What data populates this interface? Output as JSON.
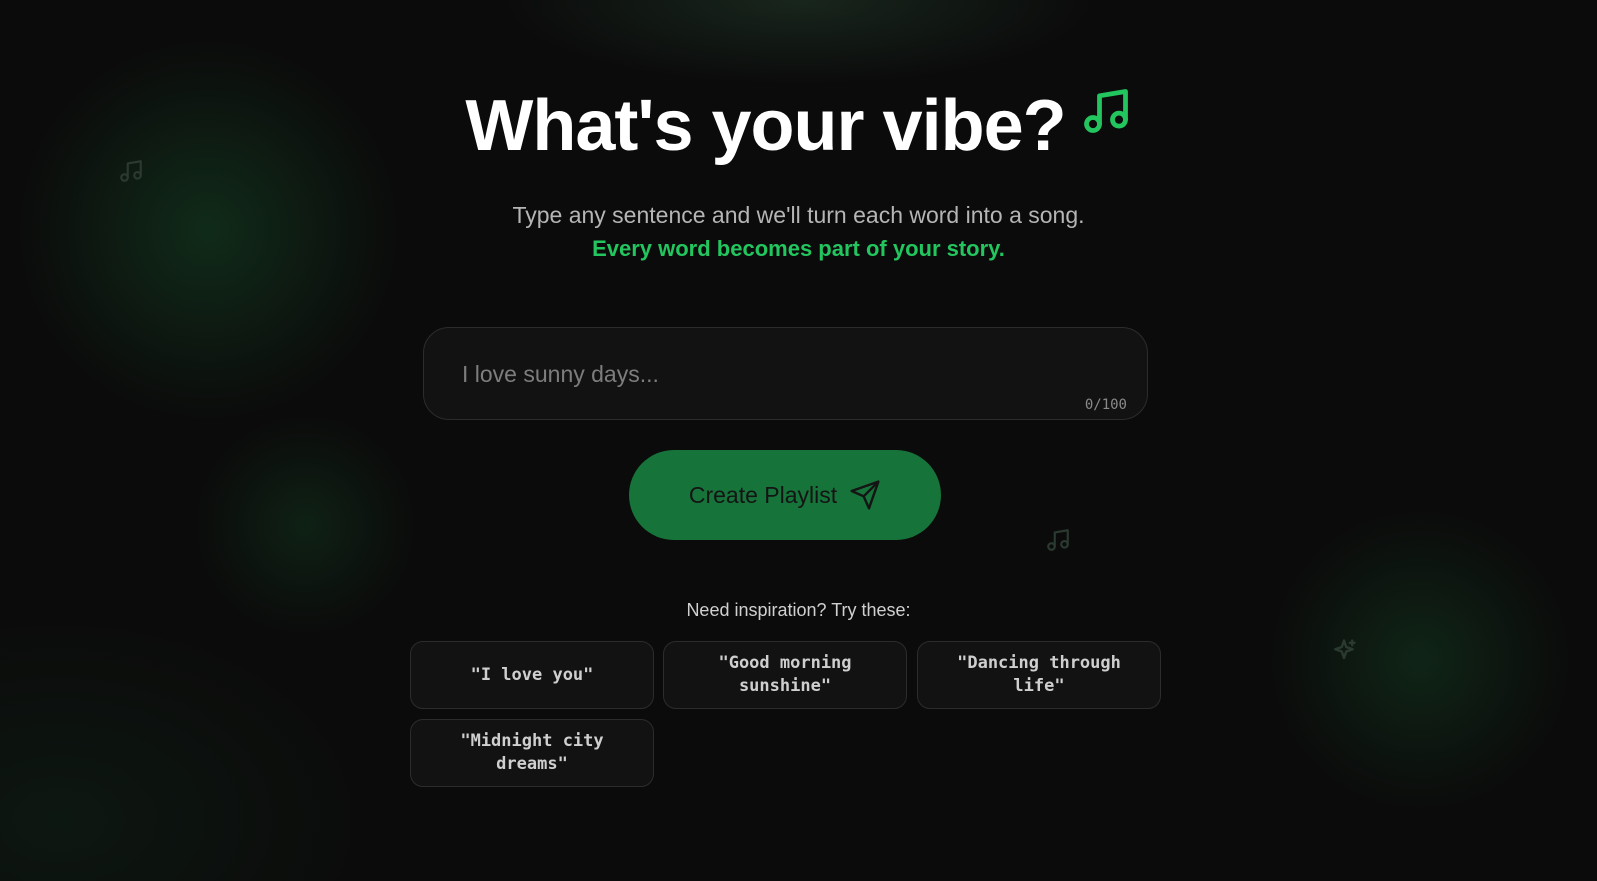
{
  "hero": {
    "title": "What's your vibe?",
    "title_icon": "music-note-icon",
    "subtitle": "Type any sentence and we'll turn each word into a song.",
    "tagline": "Every word becomes part of your story."
  },
  "input": {
    "placeholder": "I love sunny days...",
    "value": "",
    "counter": "0/100"
  },
  "create_button": {
    "label": "Create Playlist",
    "icon": "send-icon"
  },
  "inspiration": {
    "label": "Need inspiration? Try these:",
    "chips": [
      "\"I love you\"",
      "\"Good morning sunshine\"",
      "\"Dancing through life\"",
      "\"Midnight city dreams\""
    ]
  },
  "decorations": [
    "music-note-icon",
    "music-note-icon",
    "sparkle-icon"
  ],
  "colors": {
    "accent": "#22c55e",
    "button": "#16743a",
    "background": "#0b0b0b"
  }
}
